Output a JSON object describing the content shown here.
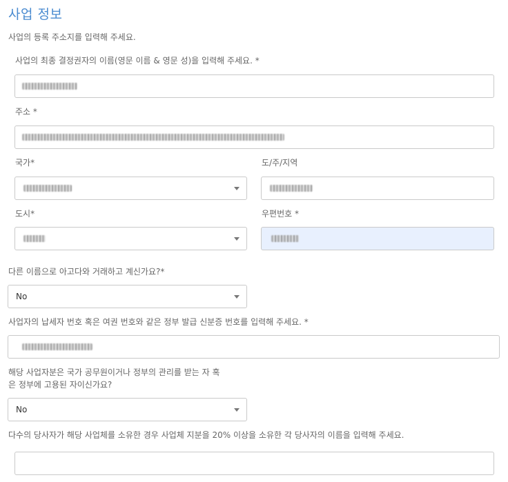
{
  "section": {
    "title": "사업 정보",
    "subtitle": "사업의 등록 주소지를 입력해 주세요."
  },
  "decision_maker": {
    "label": "사업의 최종 결정권자의 이름(영문 이름 & 영문 성)을 입력해 주세요. *"
  },
  "address": {
    "label": "주소 *"
  },
  "country": {
    "label": "국가*"
  },
  "region": {
    "label": "도/주/지역"
  },
  "city": {
    "label": "도시*"
  },
  "postal": {
    "label": "우편번호 *"
  },
  "other_name": {
    "label": "다른 이름으로 아고다와 거래하고 계신가요?*",
    "value": "No"
  },
  "tax_id": {
    "label": "사업자의 납세자 번호 혹은 여권 번호와 같은 정부 발급 신분증 번호를 입력해 주세요. *"
  },
  "gov_official": {
    "label_line1": "해당 사업자분은 국가 공무원이거나 정부의 관리를 받는 자 혹",
    "label_line2": "은 정부에 고용된 자이신가요?",
    "value": "No"
  },
  "owners": {
    "label": "다수의 당사자가 해당 사업체를 소유한 경우 사업체 지분을 20% 이상을 소유한 각 당사자의 이름을 입력해 주세요."
  }
}
